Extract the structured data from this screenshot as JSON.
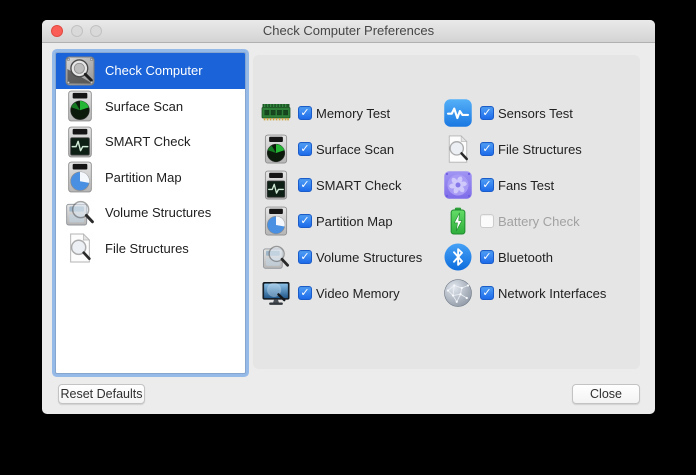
{
  "window_title": "Check Computer Preferences",
  "traffic_lights": {
    "close": "active-red",
    "minimize": "inactive",
    "zoom": "inactive"
  },
  "sidebar": {
    "items": [
      {
        "label": "Check Computer",
        "icon": "check-computer-icon",
        "selected": true
      },
      {
        "label": "Surface Scan",
        "icon": "surface-scan-icon",
        "selected": false
      },
      {
        "label": "SMART Check",
        "icon": "smart-check-icon",
        "selected": false
      },
      {
        "label": "Partition Map",
        "icon": "partition-map-icon",
        "selected": false
      },
      {
        "label": "Volume Structures",
        "icon": "volume-structures-icon",
        "selected": false
      },
      {
        "label": "File Structures",
        "icon": "file-structures-icon",
        "selected": false
      }
    ]
  },
  "main": {
    "left_rows": [
      {
        "label": "Memory Test",
        "icon": "memory-test-icon",
        "checked": true,
        "disabled": false
      },
      {
        "label": "Surface Scan",
        "icon": "surface-scan-icon",
        "checked": true,
        "disabled": false
      },
      {
        "label": "SMART Check",
        "icon": "smart-check-icon",
        "checked": true,
        "disabled": false
      },
      {
        "label": "Partition Map",
        "icon": "partition-map-icon",
        "checked": true,
        "disabled": false
      },
      {
        "label": "Volume Structures",
        "icon": "volume-structures-icon",
        "checked": true,
        "disabled": false
      },
      {
        "label": "Video Memory",
        "icon": "video-memory-icon",
        "checked": true,
        "disabled": false
      }
    ],
    "right_rows": [
      {
        "label": "Sensors Test",
        "icon": "sensors-test-icon",
        "checked": true,
        "disabled": false
      },
      {
        "label": "File Structures",
        "icon": "file-structures-icon",
        "checked": true,
        "disabled": false
      },
      {
        "label": "Fans Test",
        "icon": "fans-test-icon",
        "checked": true,
        "disabled": false
      },
      {
        "label": "Battery Check",
        "icon": "battery-check-icon",
        "checked": false,
        "disabled": true
      },
      {
        "label": "Bluetooth",
        "icon": "bluetooth-icon",
        "checked": true,
        "disabled": false
      },
      {
        "label": "Network Interfaces",
        "icon": "network-interfaces-icon",
        "checked": true,
        "disabled": false
      }
    ]
  },
  "footer": {
    "reset_label": "Reset Defaults",
    "close_label": "Close"
  },
  "colors": {
    "window_bg": "#ececec",
    "panel_bg": "#e5e5e5",
    "selection_blue": "#1a63d8",
    "checkbox_blue": "#2b76ea",
    "disabled_text": "#a2a2a2",
    "traffic_red": "#fb5d57"
  }
}
